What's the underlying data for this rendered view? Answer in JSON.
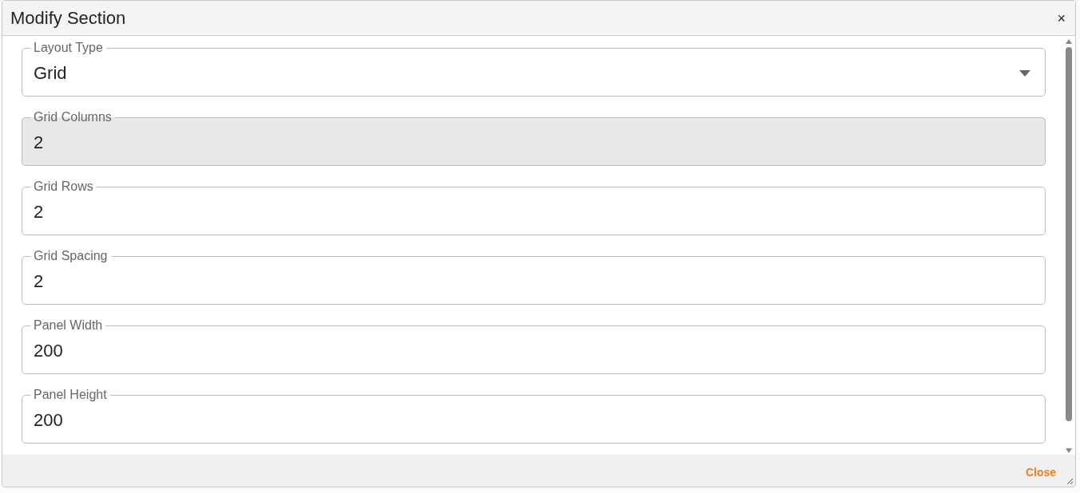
{
  "dialog": {
    "title": "Modify Section",
    "close_icon": "×"
  },
  "fields": [
    {
      "kind": "select",
      "label": "Layout Type",
      "value": "Grid",
      "highlighted": false
    },
    {
      "kind": "number",
      "label": "Grid Columns",
      "value": "2",
      "highlighted": true
    },
    {
      "kind": "number",
      "label": "Grid Rows",
      "value": "2",
      "highlighted": false
    },
    {
      "kind": "number",
      "label": "Grid Spacing",
      "value": "2",
      "highlighted": false
    },
    {
      "kind": "number",
      "label": "Panel Width",
      "value": "200",
      "highlighted": false
    },
    {
      "kind": "number",
      "label": "Panel Height",
      "value": "200",
      "highlighted": false
    }
  ],
  "footer": {
    "button": "Close"
  }
}
